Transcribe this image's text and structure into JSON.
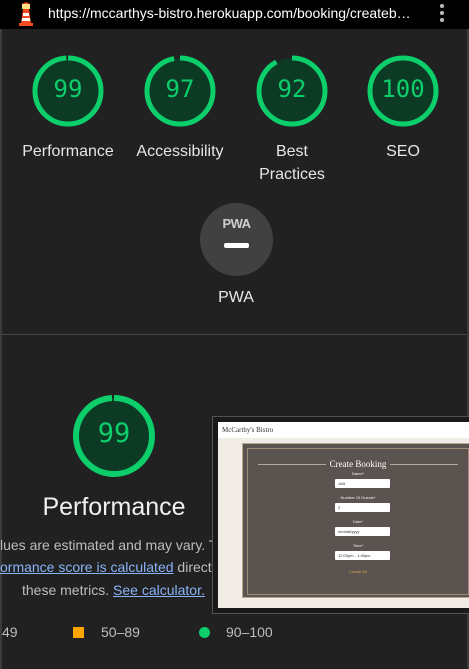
{
  "browser": {
    "url": "https://mccarthys-bistro.herokuapp.com/booking/createb…"
  },
  "scores": [
    {
      "label": "Performance",
      "value": "99",
      "fraction": 0.99
    },
    {
      "label": "Accessibility",
      "value": "97",
      "fraction": 0.97
    },
    {
      "label": "Best Practices",
      "value": "92",
      "fraction": 0.92
    },
    {
      "label": "SEO",
      "value": "100",
      "fraction": 1.0
    }
  ],
  "pwa": {
    "badge": "PWA",
    "label": "PWA"
  },
  "performance": {
    "score": "99",
    "fraction": 0.99,
    "title": "Performance",
    "desc_line1": "lues are estimated and may vary. T",
    "desc_link": "ormance score is calculated",
    "desc_line2_rest": " directly",
    "desc_line3": "these metrics.",
    "calc_link": "See calculator."
  },
  "legend": {
    "fail": "49",
    "average": "50–89",
    "pass": "90–100"
  },
  "colors": {
    "pass": "#0cce6b",
    "average": "#ffa400",
    "fail": "#ff4e42",
    "link": "#8ab4f8"
  },
  "thumbnail": {
    "site_name": "McCarthy's Bistro",
    "title": "Create Booking",
    "fields": [
      {
        "label": "Name*",
        "value": "Julit"
      },
      {
        "label": "Number Of Guests*",
        "value": "2"
      },
      {
        "label": "Date*",
        "value": "mm/dd/yyyy"
      },
      {
        "label": "Time*",
        "value": "12:00pm - 1:45pm"
      }
    ],
    "submit": "Create Ba"
  }
}
